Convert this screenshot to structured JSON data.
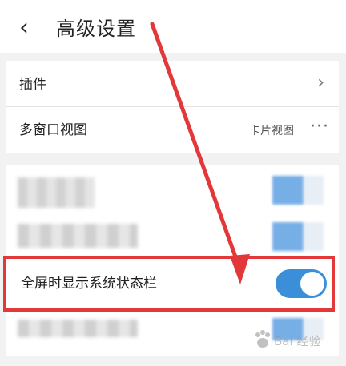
{
  "header": {
    "back_icon": "chevron-left-icon",
    "title": "高级设置"
  },
  "settings": [
    {
      "label": "插件",
      "chevron": "›"
    },
    {
      "label": "多窗口视图",
      "value": "卡片视图",
      "more": "···"
    }
  ],
  "highlighted_setting": {
    "label": "全屏时显示系统状态栏",
    "toggle_state": "on"
  },
  "colors": {
    "toggle_on": "#3b8fd8",
    "annotation": "#e2383a"
  },
  "watermark": {
    "text": "Bai 经验"
  }
}
